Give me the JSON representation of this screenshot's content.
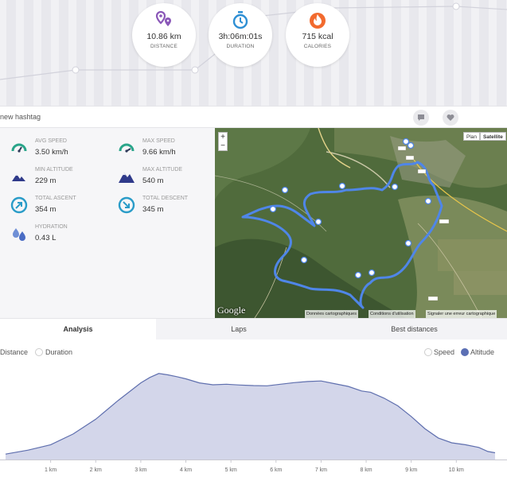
{
  "summary": {
    "distance": {
      "value": "10.86 km",
      "label": "DISTANCE",
      "icon": "map-pins-icon",
      "color": "#8a57b8"
    },
    "duration": {
      "value": "3h:06m:01s",
      "label": "DURATION",
      "icon": "stopwatch-icon",
      "color": "#2e8fd4"
    },
    "calories": {
      "value": "715 kcal",
      "label": "CALORIES",
      "icon": "flame-icon",
      "color": "#f26a2e"
    }
  },
  "hashtag": {
    "text": "new hashtag"
  },
  "metrics": [
    {
      "label": "AVG SPEED",
      "value": "3.50 km/h",
      "icon": "speedometer-icon"
    },
    {
      "label": "MAX SPEED",
      "value": "9.66 km/h",
      "icon": "speedometer-icon"
    },
    {
      "label": "MIN ALTITUDE",
      "value": "229 m",
      "icon": "mountain-icon"
    },
    {
      "label": "MAX ALTITUDE",
      "value": "540 m",
      "icon": "mountain-icon"
    },
    {
      "label": "TOTAL ASCENT",
      "value": "354 m",
      "icon": "ascent-arrow-icon"
    },
    {
      "label": "TOTAL DESCENT",
      "value": "345 m",
      "icon": "descent-arrow-icon"
    },
    {
      "label": "HYDRATION",
      "value": "0.43 L",
      "icon": "water-drops-icon"
    }
  ],
  "map": {
    "zoom_in": "+",
    "zoom_out": "−",
    "type_plan": "Plan",
    "type_satellite": "Satellite",
    "logo": "Google",
    "attribution_data": "Données cartographiques",
    "attribution_terms": "Conditions d'utilisation",
    "attribution_report": "Signaler une erreur cartographique",
    "route_color": "#4f86e8",
    "km_markers": [
      "1",
      "2",
      "3",
      "4",
      "5",
      "6",
      "7",
      "8",
      "9",
      "10"
    ]
  },
  "tabs": [
    {
      "label": "Analysis",
      "active": true
    },
    {
      "label": "Laps",
      "active": false
    },
    {
      "label": "Best distances",
      "active": false
    }
  ],
  "chart_options": {
    "x_distance": "Distance",
    "x_duration": "Duration",
    "y_speed": "Speed",
    "y_altitude": "Altitude"
  },
  "chart_data": {
    "type": "area",
    "series": [
      {
        "name": "Altitude",
        "x": [
          0,
          0.5,
          1.0,
          1.5,
          2.0,
          2.5,
          3.0,
          3.2,
          3.4,
          3.6,
          3.8,
          4.0,
          4.3,
          4.6,
          4.9,
          5.2,
          5.5,
          5.8,
          6.1,
          6.4,
          6.7,
          7.0,
          7.3,
          7.6,
          7.9,
          8.1,
          8.4,
          8.7,
          9.0,
          9.3,
          9.6,
          9.9,
          10.2,
          10.5,
          10.7,
          10.86
        ],
        "y": [
          240,
          255,
          275,
          315,
          370,
          440,
          505,
          525,
          540,
          535,
          528,
          520,
          505,
          498,
          500,
          497,
          495,
          494,
          500,
          506,
          510,
          512,
          502,
          492,
          475,
          470,
          448,
          420,
          380,
          335,
          300,
          282,
          275,
          265,
          250,
          245
        ]
      }
    ],
    "x_ticks": [
      "1 km",
      "2 km",
      "3 km",
      "4 km",
      "5 km",
      "6 km",
      "7 km",
      "8 km",
      "9 km",
      "10 km"
    ],
    "xlim": [
      0,
      10.86
    ],
    "ylim": [
      220,
      560
    ],
    "fill_color": "#d3d6ea",
    "line_color": "#5f6fae"
  }
}
